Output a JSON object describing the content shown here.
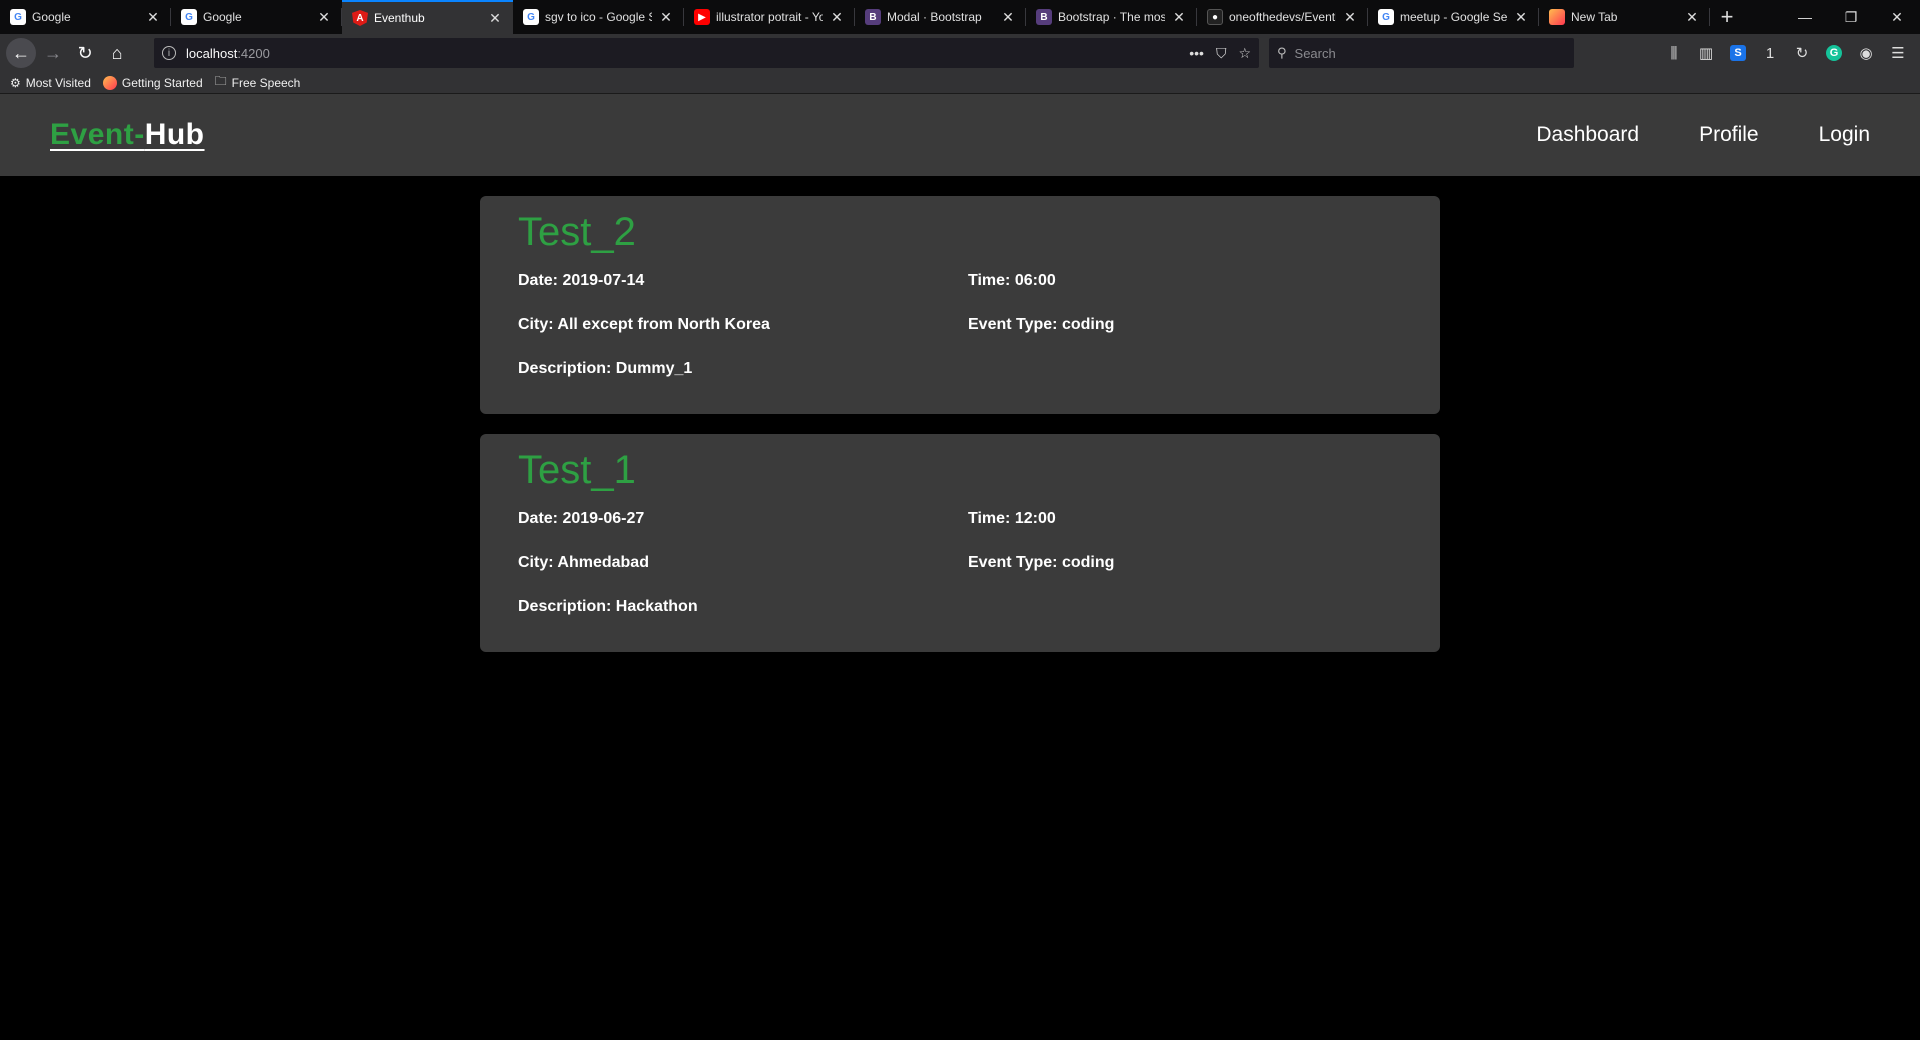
{
  "browser": {
    "tabs": [
      {
        "title": "Google",
        "favicon": "G",
        "kind": "google"
      },
      {
        "title": "Google",
        "favicon": "G",
        "kind": "google"
      },
      {
        "title": "Eventhub",
        "favicon": "A",
        "kind": "angular",
        "active": true
      },
      {
        "title": "sgv to ico - Google S",
        "favicon": "G",
        "kind": "google"
      },
      {
        "title": "illustrator potrait - Yo",
        "favicon": "▶",
        "kind": "youtube"
      },
      {
        "title": "Modal · Bootstrap",
        "favicon": "B",
        "kind": "bootstrap"
      },
      {
        "title": "Bootstrap · The most",
        "favicon": "B",
        "kind": "bootstrap"
      },
      {
        "title": "oneofthedevs/Eventh",
        "favicon": "●",
        "kind": "github"
      },
      {
        "title": "meetup - Google Sea",
        "favicon": "G",
        "kind": "google"
      },
      {
        "title": "New Tab",
        "favicon": "",
        "kind": "firefox"
      }
    ],
    "url_host": "localhost",
    "url_port": ":4200",
    "search_placeholder": "Search",
    "bookmarks": [
      {
        "label": "Most Visited",
        "icon": "gear-icon"
      },
      {
        "label": "Getting Started",
        "icon": "firefox-icon"
      },
      {
        "label": "Free Speech",
        "icon": "folder-icon"
      }
    ],
    "extension_badge": "1"
  },
  "site": {
    "logo_part1": "Event-",
    "logo_part2": "Hub",
    "nav": [
      "Dashboard",
      "Profile",
      "Login"
    ]
  },
  "events": [
    {
      "title": "Test_2",
      "date": "Date: 2019-07-14",
      "time": "Time: 06:00",
      "city": "City: All except from North Korea",
      "event_type": "Event Type: coding",
      "description": "Description: Dummy_1"
    },
    {
      "title": "Test_1",
      "date": "Date: 2019-06-27",
      "time": "Time: 12:00",
      "city": "City: Ahmedabad",
      "event_type": "Event Type: coding",
      "description": "Description: Hackathon"
    }
  ],
  "colors": {
    "accent_green": "#2ea043",
    "header_bg": "#3a3a3a",
    "card_bg": "#3b3b3b",
    "page_bg": "#000000"
  }
}
